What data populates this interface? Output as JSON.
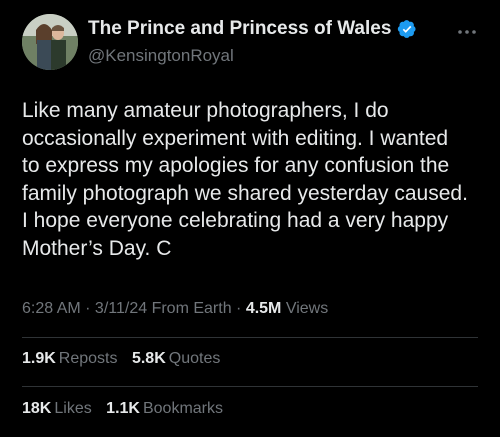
{
  "author": {
    "display_name": "The Prince and Princess of Wales",
    "handle": "@KensingtonRoyal",
    "verified_icon": "verified-badge-icon",
    "verified_color": "#1d9bf0"
  },
  "tweet": {
    "text": "Like many amateur photographers, I do\noccasionally experiment with editing. I wanted\nto express my apologies for any confusion the\nfamily photograph we shared yesterday caused.\nI hope everyone celebrating had a very happy\nMother’s Day. C"
  },
  "meta": {
    "time": "6:28 AM",
    "sep1": " · ",
    "date": "3/11/24",
    "location": " From Earth",
    "sep2": " · ",
    "views_count": "4.5M",
    "views_label": " Views"
  },
  "stats": {
    "reposts_count": "1.9K",
    "reposts_label": "Reposts",
    "quotes_count": "5.8K",
    "quotes_label": "Quotes",
    "likes_count": "18K",
    "likes_label": "Likes",
    "bookmarks_count": "1.1K",
    "bookmarks_label": "Bookmarks"
  },
  "icons": {
    "more": "more-horizontal-icon"
  },
  "colors": {
    "background": "#000000",
    "text_primary": "#e7e9ea",
    "text_secondary": "#71767b",
    "divider": "#2f3336"
  }
}
